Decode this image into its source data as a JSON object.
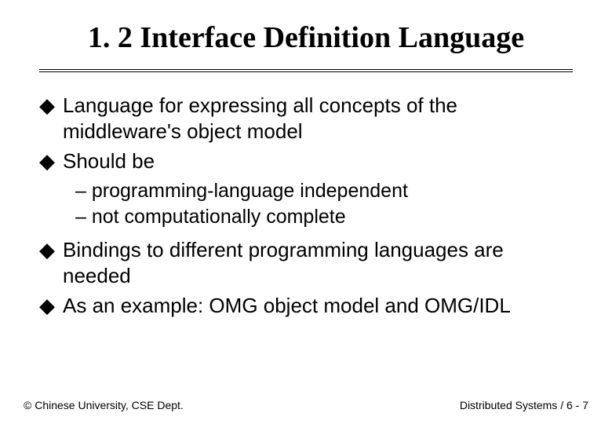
{
  "title": "1. 2 Interface Definition Language",
  "bullets": [
    {
      "text": "Language for expressing all concepts of the middleware's object model"
    },
    {
      "text": "Should be"
    }
  ],
  "subbullets": [
    {
      "text": "– programming-language independent"
    },
    {
      "text": "– not computationally complete"
    }
  ],
  "bullets2": [
    {
      "text": "Bindings to different programming languages are needed"
    },
    {
      "text": "As an example: OMG object model and OMG/IDL"
    }
  ],
  "bullet_mark": "◆",
  "footer": {
    "left": "© Chinese University, CSE Dept.",
    "right": "Distributed Systems / 6 - 7"
  }
}
